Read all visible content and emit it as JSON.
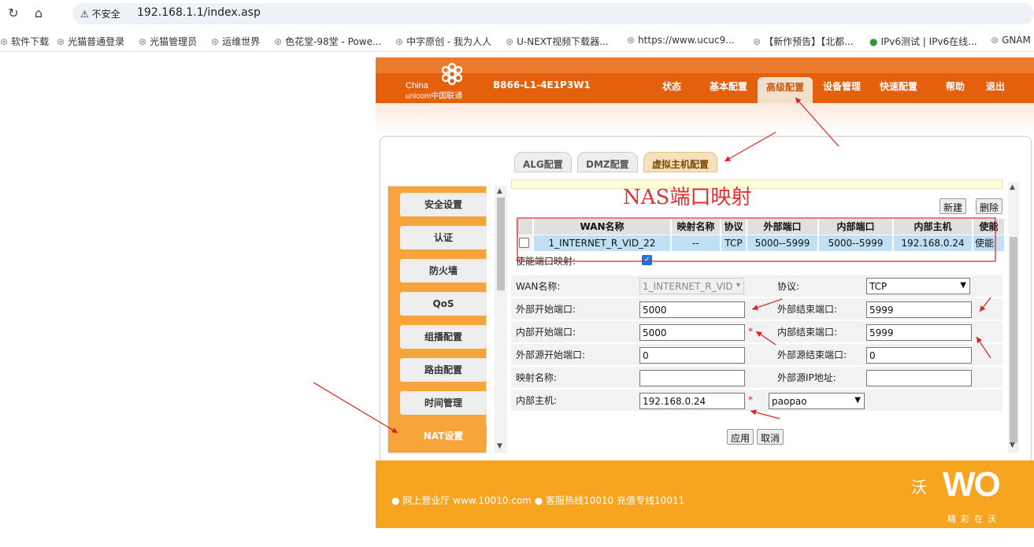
{
  "browser": {
    "security_label": "不安全",
    "url": "192.168.1.1/index.asp",
    "bookmarks": [
      "软件下载",
      "光猫普通登录",
      "光猫管理员",
      "运维世界",
      "色花堂-98堂 - Powe...",
      "中字原创 - 我为人人",
      "U-NEXT视频下载器...",
      "https://www.ucuc9...",
      "【新作预告】【北都...",
      "IPv6测试 | IPv6在线...",
      "GNAM"
    ]
  },
  "header": {
    "logo_en_1": "China",
    "logo_en_2": "unicom中国联通",
    "model": "B866-L1-4E1P3W1",
    "nav": [
      "状态",
      "基本配置",
      "高级配置",
      "设备管理",
      "快速配置",
      "帮助",
      "退出"
    ],
    "active_nav": "高级配置"
  },
  "tabs": [
    "ALG配置",
    "DMZ配置",
    "虚拟主机配置"
  ],
  "active_tab": "虚拟主机配置",
  "side_menu": [
    "安全设置",
    "认证",
    "防火墙",
    "QoS",
    "组播配置",
    "路由配置",
    "时间管理",
    "NAT设置"
  ],
  "active_side": "NAT设置",
  "annotation": "NAS端口映射",
  "actions": {
    "new": "新建",
    "delete": "删除"
  },
  "table": {
    "headers": [
      "WAN名称",
      "映射名称",
      "协议",
      "外部端口",
      "内部端口",
      "内部主机",
      "使能"
    ],
    "rows": [
      [
        "1_INTERNET_R_VID_22",
        "--",
        "TCP",
        "5000--5999",
        "5000--5999",
        "192.168.0.24",
        "使能"
      ]
    ]
  },
  "form": {
    "enable_label": "使能端口映射:",
    "enable_checked": "✓",
    "wan_label": "WAN名称:",
    "wan_value": "1_INTERNET_R_VID",
    "protocol_label": "协议:",
    "protocol_value": "TCP",
    "ext_start_label": "外部开始端口:",
    "ext_start_value": "5000",
    "ext_end_label": "外部结束端口:",
    "ext_end_value": "5999",
    "int_start_label": "内部开始端口:",
    "int_start_value": "5000",
    "int_end_label": "内部结束端口:",
    "int_end_value": "5999",
    "src_start_label": "外部源开始端口:",
    "src_start_value": "0",
    "src_end_label": "外部源结束端口:",
    "src_end_value": "0",
    "map_name_label": "映射名称:",
    "map_name_value": "",
    "src_ip_label": "外部源IP地址:",
    "src_ip_value": "",
    "host_label": "内部主机:",
    "host_value": "192.168.0.24",
    "host_device": "paopao",
    "required_mark": "*",
    "apply": "应用",
    "cancel": "取消"
  },
  "footer": {
    "text": "● 网上营业厅  www.10010.com ● 客服热线10010  充值专线10011",
    "brand": "沃",
    "brand_wo": "WO",
    "slogan": "精彩在沃"
  },
  "colors": {
    "header_orange": "#e4600c",
    "footer_orange": "#f7a520",
    "annotation_red": "#e03030",
    "row_blue": "#bfe0f5"
  }
}
